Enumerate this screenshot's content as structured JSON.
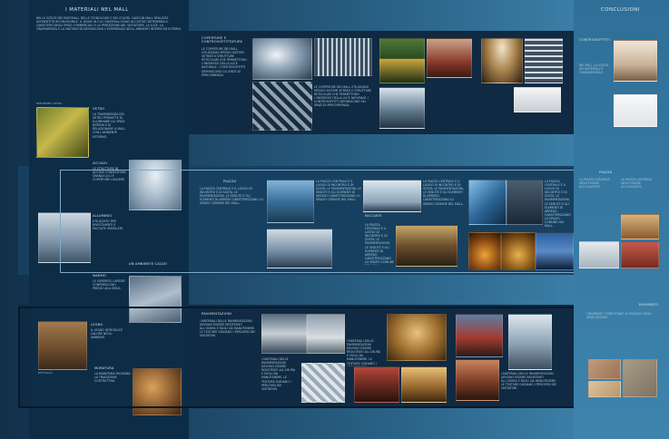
{
  "left": {
    "title": "I MATERIALI NEL MALL",
    "intro": "NELLE SCELTE DEI MATERIALI, DELLE TECNOLOGIE E DEI COLORI, CIASCUN MALL REALIZZA UN'IDENTITÀ RICONOSCIBILE. IL MODO IN CUI I MATERIALI SONO ACCOSTATI DETERMINA IL CARATTERE DEGLI SPAZI COMMERCIALI E LA PERCEZIONE DEL VISITATORE. LA LUCE, LA TRASPARENZA E LA MATERICITÀ DEFINISCONO L'ESPERIENZA DEGLI AMBIENTI INTERNI ED ESTERNI.",
    "sections": [
      {
        "label": "VETRO",
        "text": "LA TRASPARENZA DEL VETRO PERMETTE DI ILLUMINARE GLI SPAZI INTERNI E DI RELAZIONARE IL MALL CON L'AMBIENTE ESTERNO."
      },
      {
        "label": "ACCIAIO",
        "text": "LE STRUTTURE IN ACCIAIO CONSENTONO GRANDI LUCI E COPERTURE LEGGERE."
      },
      {
        "label": "ALLUMINIO",
        "text": "UTILIZZATO PER RIVESTIMENTI E FACCIATE VENTILATE."
      },
      {
        "label": "MARMO",
        "text": "LE SUPERFICI LAPIDEE CONFERISCONO PREGIO AGLI SPAZI."
      },
      {
        "label": "LEGNO",
        "text": "IL LEGNO INTRODUCE CALORE NEGLI AMBIENTI."
      },
      {
        "label": "MURATURA",
        "text": "LA MURATURA RICHIAMA LA TRADIZIONE COSTRUTTIVA."
      }
    ],
    "caption1": "PRECEDENT: VETRO",
    "mid_caption": "UN AMBIENTE CALDO",
    "photo_caption": "DETTAGLIO"
  },
  "top": {
    "heading": "COPERTURE E CONTROSOFFITTATURE",
    "text": "LE COPERTURE DEI MALL UTILIZZANO SPESSO SISTEMI VETRATI E STRUTTURE RETICOLARI CHE PERMETTONO L'INGRESSO DELLA LUCE NATURALE. I CONTROSOFFITTI DEFINISCONO GLI SPAZI DI PERCORRENZA."
  },
  "middle": {
    "heading": "PIAZZA",
    "text": "LA PIAZZA CENTRALE È IL LUOGO DI INCONTRO E DI SOSTA. LE PAVIMENTAZIONI, LE SEDUTE E GLI ELEMENTI DI ARREDO CARATTERIZZANO LO SPAZIO COMUNE DEL MALL.",
    "captions": [
      "FACCIATE",
      "ESEMPIO",
      "ESTERNO",
      "INTERNO",
      "NIGHT VIEW"
    ]
  },
  "bottom": {
    "heading": "PAVIMENTAZIONI",
    "text": "I MATERIALI DELLE PAVIMENTAZIONI DEVONO ESSERE RESISTENTI ALL'USURA E FACILI DA MANUTENERE. LE TEXTURE GUIDANO I PERCORSI DEI VISITATORI.",
    "captions": [
      "GALLERIA",
      "NEGOZIO",
      "ESTERNO"
    ]
  },
  "right": {
    "title": "CONCLUSIONI",
    "sub1": "CONTROSOFFITTI",
    "sub2": "PIAZZA",
    "sub3": "PAVIMENTI",
    "text1": "NEI MALL LA SCELTA DEI MATERIALI È FONDAMENTALE.",
    "text2": "LA PIAZZA CENTRALE DEVE ESSERE ACCOGLIENTE.",
    "text3": "I PAVIMENTI COMPLETANO IL DISEGNO DEGLI SPAZI INTERNI."
  },
  "colors": {
    "left_panel": "#0d2d47",
    "frame": "#7fa9c7",
    "accent": "#3d82aa"
  }
}
